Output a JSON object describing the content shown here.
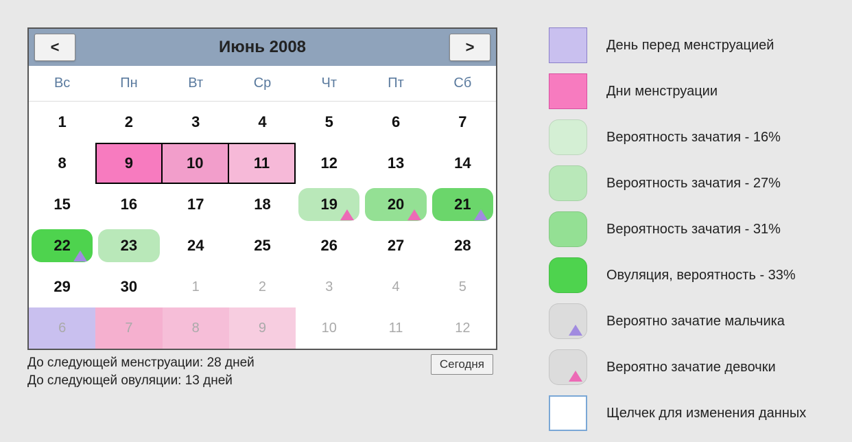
{
  "header": {
    "month_title": "Июнь 2008",
    "prev_label": "<",
    "next_label": ">"
  },
  "weekdays": [
    "Вс",
    "Пн",
    "Вт",
    "Ср",
    "Чт",
    "Пт",
    "Сб"
  ],
  "weeks": [
    [
      {
        "d": "1",
        "other": false,
        "style": ""
      },
      {
        "d": "2",
        "other": false,
        "style": ""
      },
      {
        "d": "3",
        "other": false,
        "style": ""
      },
      {
        "d": "4",
        "other": false,
        "style": ""
      },
      {
        "d": "5",
        "other": false,
        "style": ""
      },
      {
        "d": "6",
        "other": false,
        "style": ""
      },
      {
        "d": "7",
        "other": false,
        "style": ""
      }
    ],
    [
      {
        "d": "8",
        "other": false,
        "style": ""
      },
      {
        "d": "9",
        "other": false,
        "style": "period1"
      },
      {
        "d": "10",
        "other": false,
        "style": "period2"
      },
      {
        "d": "11",
        "other": false,
        "style": "period3"
      },
      {
        "d": "12",
        "other": false,
        "style": ""
      },
      {
        "d": "13",
        "other": false,
        "style": ""
      },
      {
        "d": "14",
        "other": false,
        "style": ""
      }
    ],
    [
      {
        "d": "15",
        "other": false,
        "style": ""
      },
      {
        "d": "16",
        "other": false,
        "style": ""
      },
      {
        "d": "17",
        "other": false,
        "style": ""
      },
      {
        "d": "18",
        "other": false,
        "style": ""
      },
      {
        "d": "19",
        "other": false,
        "style": "fertile-light",
        "marker": "girl"
      },
      {
        "d": "20",
        "other": false,
        "style": "fertile-mid",
        "marker": "girl"
      },
      {
        "d": "21",
        "other": false,
        "style": "fertile-strong",
        "marker": "boy"
      }
    ],
    [
      {
        "d": "22",
        "other": false,
        "style": "ovulation",
        "marker": "boy"
      },
      {
        "d": "23",
        "other": false,
        "style": "fertile-light"
      },
      {
        "d": "24",
        "other": false,
        "style": ""
      },
      {
        "d": "25",
        "other": false,
        "style": ""
      },
      {
        "d": "26",
        "other": false,
        "style": ""
      },
      {
        "d": "27",
        "other": false,
        "style": ""
      },
      {
        "d": "28",
        "other": false,
        "style": ""
      }
    ],
    [
      {
        "d": "29",
        "other": false,
        "style": ""
      },
      {
        "d": "30",
        "other": false,
        "style": ""
      },
      {
        "d": "1",
        "other": true,
        "style": ""
      },
      {
        "d": "2",
        "other": true,
        "style": ""
      },
      {
        "d": "3",
        "other": true,
        "style": ""
      },
      {
        "d": "4",
        "other": true,
        "style": ""
      },
      {
        "d": "5",
        "other": true,
        "style": ""
      }
    ],
    [
      {
        "d": "6",
        "other": true,
        "style": "pre-period"
      },
      {
        "d": "7",
        "other": true,
        "style": "next-period1"
      },
      {
        "d": "8",
        "other": true,
        "style": "next-period2"
      },
      {
        "d": "9",
        "other": true,
        "style": "next-period3"
      },
      {
        "d": "10",
        "other": true,
        "style": ""
      },
      {
        "d": "11",
        "other": true,
        "style": ""
      },
      {
        "d": "12",
        "other": true,
        "style": ""
      }
    ]
  ],
  "status": {
    "line1": "До следующей менструации: 28 дней",
    "line2": "До следующей овуляции: 13 дней",
    "today_btn": "Сегодня"
  },
  "legend": {
    "pre_period": "День перед менструацией",
    "period": "Дни менструации",
    "c16": "Вероятность зачатия - 16%",
    "c27": "Вероятность зачатия - 27%",
    "c31": "Вероятность зачатия - 31%",
    "ovu": "Овуляция, вероятность - 33%",
    "boy": "Вероятно зачатие мальчика",
    "girl": "Вероятно зачатие девочки",
    "click": "Щелчек для изменения данных"
  }
}
